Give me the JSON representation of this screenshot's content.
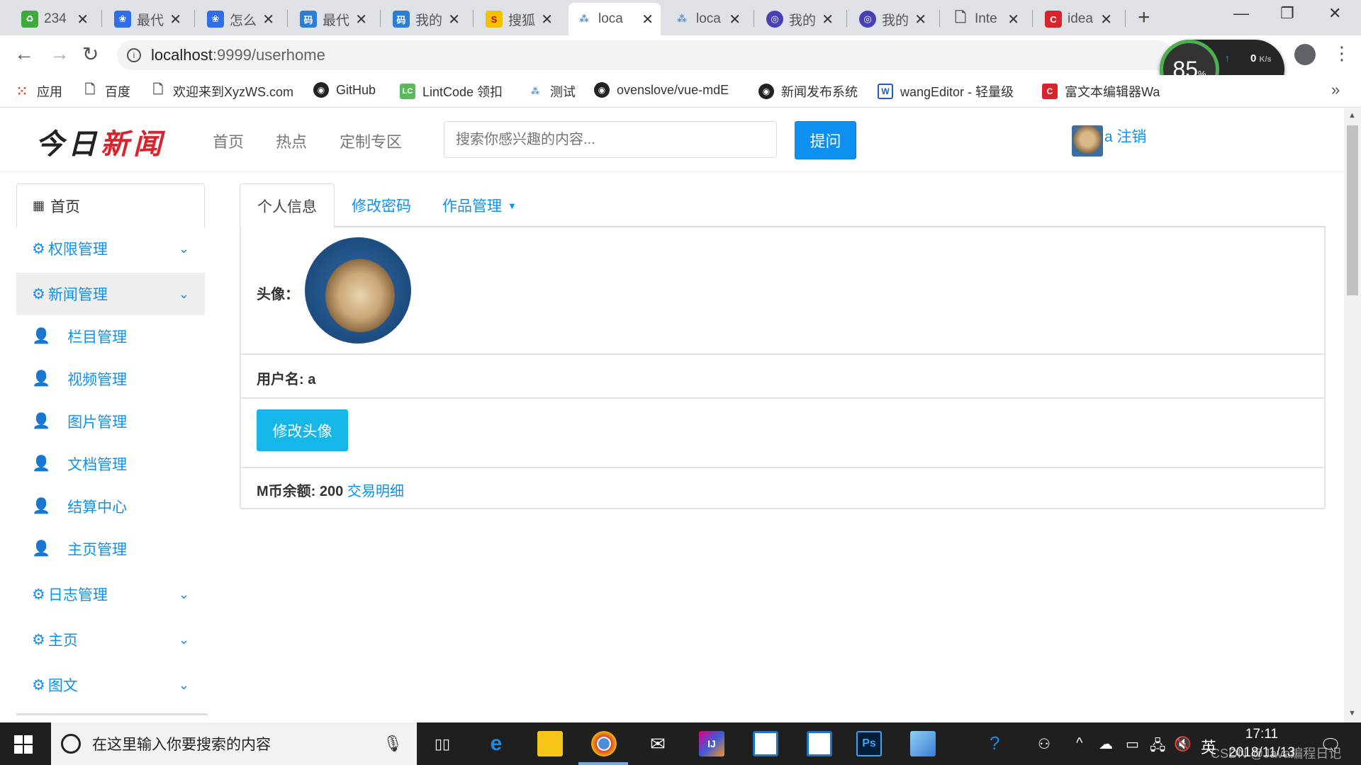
{
  "browser": {
    "tabs": [
      {
        "title": "234",
        "icon": "recycle-icon",
        "color": "#3cab3c"
      },
      {
        "title": "最代",
        "icon": "baidu-paw-icon",
        "color": "#2f6ee8"
      },
      {
        "title": "怎么",
        "icon": "baidu-paw-icon",
        "color": "#2f6ee8"
      },
      {
        "title": "最代",
        "icon": "zuidaima-icon",
        "color": "#2a7fd4"
      },
      {
        "title": "我的",
        "icon": "zuidaima-icon",
        "color": "#2a7fd4"
      },
      {
        "title": "搜狐",
        "icon": "sohu-icon",
        "color": "#f2c200"
      },
      {
        "title": "loca",
        "icon": "local-app-icon",
        "color": "#ffffff"
      },
      {
        "title": "loca",
        "icon": "local-app-icon",
        "color": "#dee1e6"
      },
      {
        "title": "我的",
        "icon": "globe-icon",
        "color": "#4a3fb5"
      },
      {
        "title": "我的",
        "icon": "globe-icon",
        "color": "#4a3fb5"
      },
      {
        "title": "Inte",
        "icon": "page-icon",
        "color": "#dee1e6"
      },
      {
        "title": "idea",
        "icon": "csdn-icon",
        "color": "#d9232d"
      }
    ],
    "url_host": "localhost",
    "url_rest": ":9999/userhome",
    "speed": {
      "percent": "85",
      "percent_unit": "%",
      "up": "0",
      "down": "0",
      "unit": "K/s"
    },
    "bookmarks": [
      {
        "label": "应用",
        "icon": "apps-grid-icon"
      },
      {
        "label": "百度",
        "icon": "page-icon"
      },
      {
        "label": "欢迎来到XyzWS.com",
        "icon": "page-icon"
      },
      {
        "label": "GitHub",
        "icon": "github-icon"
      },
      {
        "label": "LintCode 领扣",
        "icon": "lintcode-icon"
      },
      {
        "label": "测试",
        "icon": "local-app-icon"
      },
      {
        "label": "ovenslove/vue-mdE",
        "icon": "github-icon"
      },
      {
        "label": "新闻发布系统",
        "icon": "github-icon"
      },
      {
        "label": "wangEditor - 轻量级",
        "icon": "wangeditor-icon"
      },
      {
        "label": "富文本编辑器Wa",
        "icon": "csdn-icon"
      }
    ]
  },
  "site": {
    "logo_part1": "今日",
    "logo_part2": "新闻",
    "nav": [
      "首页",
      "热点",
      "定制专区"
    ],
    "search_placeholder": "搜索你感兴趣的内容...",
    "ask_button": "提问",
    "username": "a",
    "logout": "注销"
  },
  "sidebar": {
    "home": "首页",
    "perm": "权限管理",
    "news": "新闻管理",
    "subs": [
      "栏目管理",
      "视频管理",
      "图片管理",
      "文档管理",
      "结算中心",
      "主页管理"
    ],
    "log": "日志管理",
    "main": "主页",
    "article": "图文"
  },
  "profile": {
    "tabs": {
      "info": "个人信息",
      "password": "修改密码",
      "works": "作品管理"
    },
    "avatar_label": "头像：",
    "username_label": "用户名:",
    "username_value": "a",
    "change_avatar": "修改头像",
    "balance_label": "M币余额:",
    "balance_value": "200",
    "transactions": "交易明细"
  },
  "taskbar": {
    "search_placeholder": "在这里输入你要搜索的内容",
    "ime": "英",
    "time": "17:11",
    "date": "2018/11/13",
    "watermark": "CSDN @Java编程日记"
  }
}
